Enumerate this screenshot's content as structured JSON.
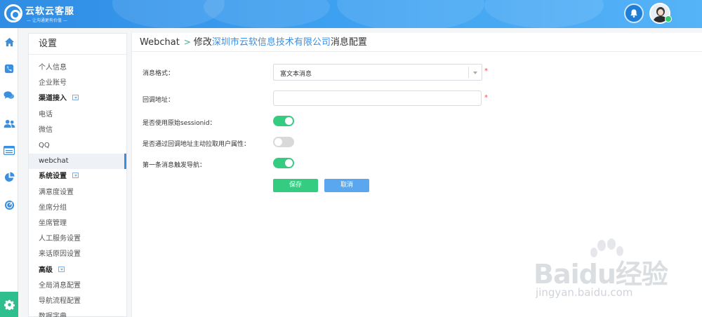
{
  "header": {
    "logo_title": "云软云客服",
    "logo_subtitle": "— 让沟通更有价值 —"
  },
  "rail": {
    "icons": [
      "home-icon",
      "phone-icon",
      "chat-icon",
      "users-icon",
      "list-icon",
      "pie-chart-icon",
      "monitor-icon",
      "settings-icon"
    ]
  },
  "menu": {
    "title": "设置",
    "items": [
      {
        "label": "个人信息",
        "type": "item"
      },
      {
        "label": "企业账号",
        "type": "item"
      },
      {
        "label": "渠道接入",
        "type": "group"
      },
      {
        "label": "电话",
        "type": "item"
      },
      {
        "label": "微信",
        "type": "item"
      },
      {
        "label": "QQ",
        "type": "item"
      },
      {
        "label": "webchat",
        "type": "item",
        "active": true
      },
      {
        "label": "系统设置",
        "type": "group"
      },
      {
        "label": "满意度设置",
        "type": "item"
      },
      {
        "label": "坐席分组",
        "type": "item"
      },
      {
        "label": "坐席管理",
        "type": "item"
      },
      {
        "label": "人工服务设置",
        "type": "item"
      },
      {
        "label": "来话原因设置",
        "type": "item"
      },
      {
        "label": "高级",
        "type": "group"
      },
      {
        "label": "全局消息配置",
        "type": "item"
      },
      {
        "label": "导航流程配置",
        "type": "item"
      },
      {
        "label": "数据字典",
        "type": "item"
      }
    ]
  },
  "breadcrumb": {
    "root": "Webchat",
    "separator": ">",
    "prefix": "修改",
    "company": "深圳市云软信息技术有限公司",
    "suffix": "消息配置"
  },
  "form": {
    "message_format_label": "消息格式：",
    "message_format_value": "富文本消息",
    "callback_url_label": "回调地址：",
    "callback_url_value": "",
    "use_original_session_label": "是否使用原始sessionid：",
    "use_original_session_on": true,
    "pull_user_attrs_label": "是否通过回调地址主动拉取用户属性：",
    "pull_user_attrs_on": false,
    "first_message_nav_label": "第一条消息触发导航：",
    "first_message_nav_on": true,
    "required_mark": "*",
    "save_label": "保存",
    "cancel_label": "取消"
  },
  "colors": {
    "header": "#3c9ff0",
    "accent_green": "#33cc80",
    "accent_blue": "#5aa7ef",
    "link_blue": "#3b8fe0"
  },
  "watermark": {
    "text": "Baidu经验",
    "url": "jingyan.baidu.com"
  }
}
